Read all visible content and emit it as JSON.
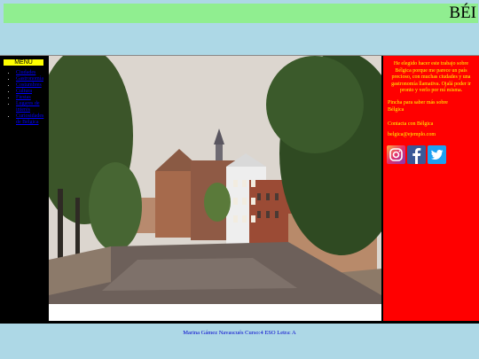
{
  "header": {
    "title": "BÉI"
  },
  "sidebar": {
    "menu_label": "MENU",
    "items": [
      {
        "label": "Ciudades"
      },
      {
        "label": "Gastronomía"
      },
      {
        "label": "Costumbres"
      },
      {
        "label": "Cultura"
      },
      {
        "label": "Fiestas"
      },
      {
        "label": "Lugares de interés"
      },
      {
        "label": "Curiosidades de Bélgica"
      }
    ]
  },
  "main": {
    "photo": {
      "subject": "canal-with-brick-houses",
      "sky": "#ddd8d0",
      "water": "#6b5e58",
      "trees": "#3f5a2c"
    }
  },
  "aside": {
    "intro": "He elegido hacer este trabajo sobre Bélgica porque me parece un país precioso, con muchas ciudades y una gastronomía llamativa. Ojalá poder ir pronto y verlo por mí misma.",
    "link_text": "Pincha para saber más sobre Bélgica",
    "contact_text": "Contacta con Bélgica",
    "email_text": "belgica@ejemplo.com",
    "socials": [
      {
        "name": "instagram-icon",
        "color": "#c13584"
      },
      {
        "name": "facebook-icon",
        "color": "#3b5998"
      },
      {
        "name": "twitter-icon",
        "color": "#1da1f2"
      }
    ]
  },
  "footer": {
    "text": "Marina Gámez Navascués Curso:4 ESO Letra: A"
  },
  "colors": {
    "background": "#add8e6",
    "header": "#90ee90",
    "aside": "#ff0000",
    "menu": "#ffff00",
    "sidebar": "#000000"
  }
}
